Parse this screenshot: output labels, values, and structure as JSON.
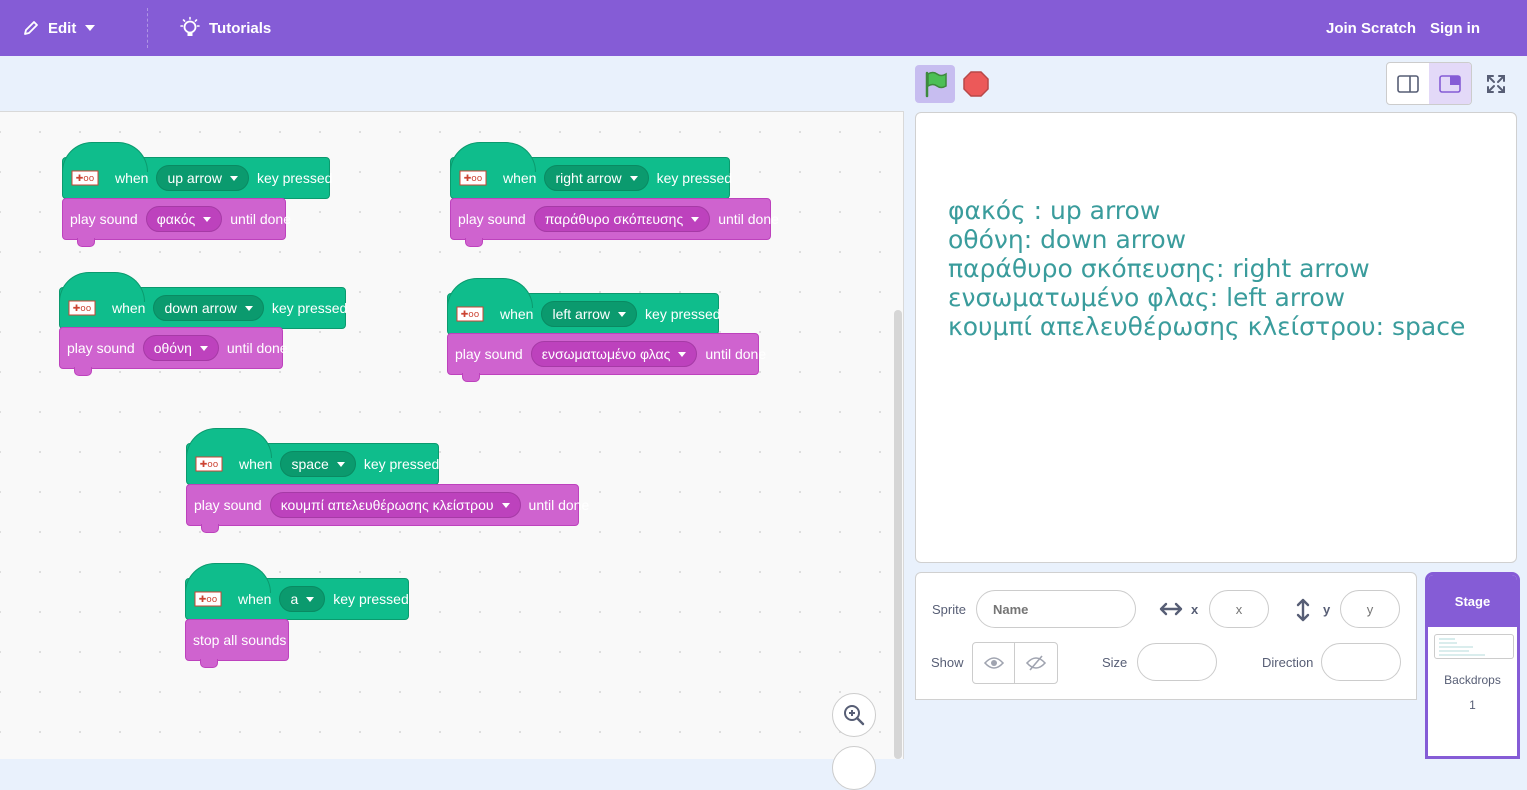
{
  "menu": {
    "edit_label": "Edit",
    "tutorials_label": "Tutorials",
    "join_label": "Join Scratch",
    "signin_label": "Sign in"
  },
  "scripts": [
    {
      "event": "when",
      "key": "up arrow",
      "suffix": "key pressed",
      "action": "play sound",
      "sound": "φακός",
      "until": "until done"
    },
    {
      "event": "when",
      "key": "right arrow",
      "suffix": "key pressed",
      "action": "play sound",
      "sound": "παράθυρο σκόπευσης",
      "until": "until done"
    },
    {
      "event": "when",
      "key": "down arrow",
      "suffix": "key pressed",
      "action": "play sound",
      "sound": "οθόνη",
      "until": "until done"
    },
    {
      "event": "when",
      "key": "left arrow",
      "suffix": "key pressed",
      "action": "play sound",
      "sound": "ενσωματωμένο φλας",
      "until": "until done"
    },
    {
      "event": "when",
      "key": "space",
      "suffix": "key pressed",
      "action": "play sound",
      "sound": "κουμπί απελευθέρωσης κλείστρου",
      "until": "until done"
    },
    {
      "event": "when",
      "key": "a",
      "suffix": "key pressed",
      "action": "stop all sounds"
    }
  ],
  "stage_text": [
    "φακός : up arrow",
    "οθόνη: down arrow",
    "παράθυρο σκόπευσης: right arrow",
    "ενσωματωμένο φλας: left arrow",
    "κουμπί απελευθέρωσης κλείστρου: space"
  ],
  "sprite_info": {
    "sprite_label": "Sprite",
    "name_placeholder": "Name",
    "x_label": "x",
    "x_placeholder": "x",
    "y_label": "y",
    "y_placeholder": "y",
    "show_label": "Show",
    "size_label": "Size",
    "direction_label": "Direction"
  },
  "stage_panel": {
    "title": "Stage",
    "backdrops_label": "Backdrops",
    "backdrops_count": "1"
  },
  "colors": {
    "menu_bg": "#855cd6",
    "events": "#0fbd8c",
    "sound": "#cf63cf",
    "stage_text": "#3a9c9c"
  }
}
